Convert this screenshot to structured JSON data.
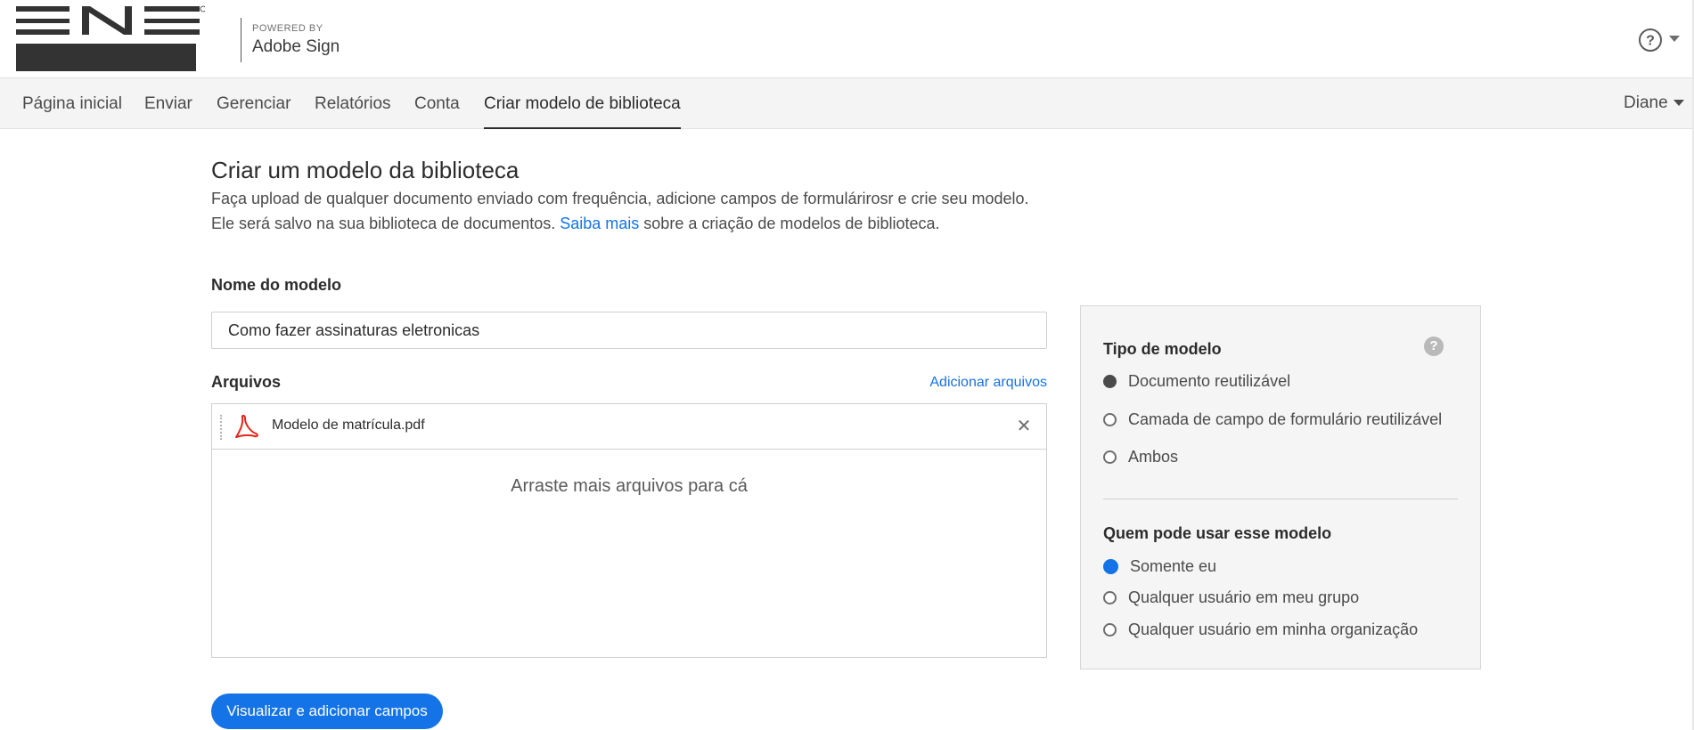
{
  "header": {
    "powered_by": "POWERED BY",
    "brand": "Adobe Sign"
  },
  "nav": {
    "items": [
      {
        "label": "Página inicial"
      },
      {
        "label": "Enviar"
      },
      {
        "label": "Gerenciar"
      },
      {
        "label": "Relatórios"
      },
      {
        "label": "Conta"
      },
      {
        "label": "Criar modelo de biblioteca"
      }
    ],
    "active_index": 5,
    "user": "Diane"
  },
  "main": {
    "title": "Criar um modelo da biblioteca",
    "description_line1": "Faça upload de qualquer documento enviado com frequência, adicione campos de formulárirosr e crie seu modelo.",
    "description_line2_before": "Ele será salvo na sua biblioteca de documentos. ",
    "description_link": "Saiba mais",
    "description_line2_after": " sobre a criação de modelos de biblioteca.",
    "name_label": "Nome do modelo",
    "name_value": "Como fazer assinaturas eletronicas",
    "files_label": "Arquivos",
    "add_files": "Adicionar arquivos",
    "files": [
      {
        "name": "Modelo de matrícula.pdf"
      }
    ],
    "dropzone": "Arraste mais arquivos para cá",
    "primary_button": "Visualizar e adicionar campos"
  },
  "panel": {
    "type_label": "Tipo de modelo",
    "type_options": [
      "Documento reutilizável",
      "Camada de campo de formulário reutilizável",
      "Ambos"
    ],
    "type_selected": 0,
    "help_glyph": "?",
    "who_label": "Quem pode usar esse modelo",
    "who_options": [
      "Somente eu",
      "Qualquer usuário em meu grupo",
      "Qualquer usuário em minha organização"
    ],
    "who_selected": 0
  },
  "colors": {
    "accent": "#1473e6",
    "pdf_red": "#e1251b"
  },
  "icons": {
    "help": "help-circle-icon",
    "remove": "close-icon",
    "file": "pdf-icon"
  }
}
